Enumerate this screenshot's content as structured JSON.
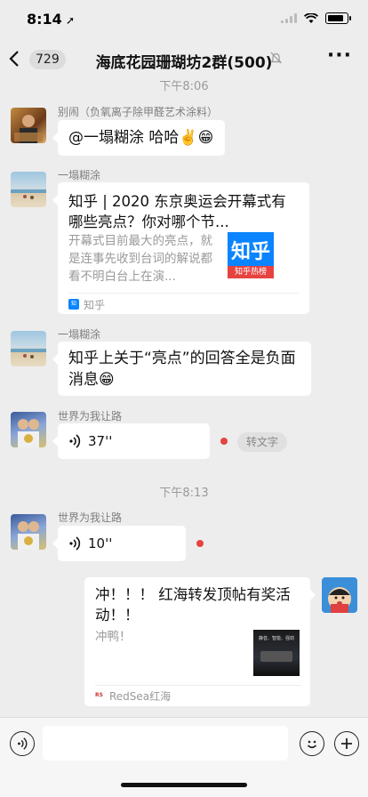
{
  "status_bar": {
    "time": "8:14"
  },
  "nav": {
    "back_count": "729",
    "title": "海底花园珊瑚坊2群(500)"
  },
  "messages": {
    "time1": "下午8:06",
    "time2": "下午8:13",
    "m1": {
      "sender": "别闹（负氧离子除甲醛艺术涂料）",
      "text": "@一塌糊涂 哈哈✌️😁"
    },
    "m2": {
      "sender": "一塌糊涂",
      "card_title": "知乎 | 2020 东京奥运会开幕式有哪些亮点？你对哪个节...",
      "card_desc": "开幕式目前最大的亮点，就是连事先收到台词的解说都看不明白台上在演...",
      "thumb_logo": "知乎",
      "thumb_caption": "知乎热榜",
      "source": "知乎"
    },
    "m3": {
      "sender": "一塌糊涂",
      "text": "知乎上关于“亮点”的回答全是负面消息😁"
    },
    "m4": {
      "sender": "世界为我让路",
      "duration": "37''",
      "transcribe": "转文字"
    },
    "m5": {
      "sender": "世界为我让路",
      "duration": "10''"
    },
    "m6": {
      "card_title": "冲！！！ 红海转发顶帖有奖活动！！",
      "card_desc": "冲鸭！",
      "thumb_text": "静音、智能、强劲",
      "source": "RedSea红海"
    }
  },
  "colors": {
    "accent_red": "#e64340",
    "zhihu_blue": "#0a84ff",
    "zhihu_red": "#e64340"
  }
}
